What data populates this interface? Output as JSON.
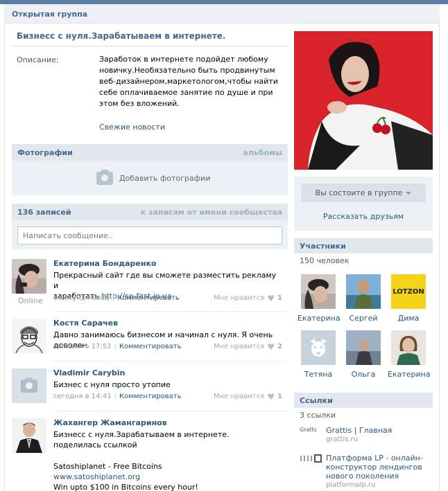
{
  "header": {
    "title": "Открытая группа"
  },
  "group": {
    "name": "Бизнесс с нуля.Зарабатываем в интернете.",
    "description_label": "Описание:",
    "description": "Заработок в интернете подойдет любому новичку.Необязательно быть продвинутым веб-дизайнером,маркетологом,чтобы найти себе оплачиваемое занятие по душе и при этом без вложений.",
    "news_link": "Свежие новости"
  },
  "photos": {
    "title": "Фотографии",
    "albums_link": "альбомы",
    "add_label": "Добавить фотографии"
  },
  "wall": {
    "count_label": "136 записей",
    "community_link": "к записям от имени сообщества",
    "input_placeholder": "Написать сообщение..",
    "posts": [
      {
        "author": "Екатерина Бондаренко",
        "online": "Online",
        "text_line1": "Прекрасный сайт где вы сможете разместить рекламу и",
        "text_line2_prefix": "заработать ",
        "text_link": "http://se-fast.io.ua",
        "time": "6 секунд назад",
        "comment": "Комментировать",
        "like_label": "Мне нравится",
        "likes": "1"
      },
      {
        "author": "Костя Сарачев",
        "text": "Давно занимаюсь бизнесом и начинал с нуля. Я очень доволен",
        "time": "сегодня в 17:52",
        "comment": "Комментировать",
        "like_label": "Мне нравится",
        "likes": "2"
      },
      {
        "author": "Vladimir Carybin",
        "text": "Бизнес с нуля просто утопие",
        "time": "сегодня в 14:41",
        "comment": "Комментировать",
        "like_label": "Мне нравится",
        "likes": "1"
      },
      {
        "author": "Жахангер Жамангаринов",
        "text": "Бизнесс с нуля.Зарабатываем в интернете. поделилась ссылкой",
        "attach_title": "Satoshiplanet - Free Bitcoins",
        "attach_url": "www.satoshiplanet.org",
        "attach_text": "Win upto $100 in Bitcoins every hour!"
      }
    ]
  },
  "sidebar": {
    "member_button": "Вы состоите в группе",
    "tell_friends": "Рассказать друзьям",
    "members_title": "Участники",
    "members_count": "150 человек",
    "members": [
      {
        "name": "Екатерина"
      },
      {
        "name": "Сергей"
      },
      {
        "name": "Дима",
        "logo": "LOTZON"
      },
      {
        "name": "Тетяна"
      },
      {
        "name": "Ольга"
      },
      {
        "name": "Екатерина"
      }
    ],
    "links_title": "Ссылки",
    "links_count": "3 ссылки",
    "links": [
      {
        "logo": "Gratts",
        "title": "Grattis | Главная",
        "url": "grattis.ru"
      },
      {
        "logo": "",
        "title": "Платформа LP - онлайн-конструктор лендингов нового поколения",
        "url": "platformalp.ru"
      }
    ]
  },
  "colors": {
    "accent": "#45688e",
    "link": "#2b587a",
    "bar": "#e1e7ed",
    "box": "#edf1f5",
    "topbar": "#597da3",
    "cover_red": "#d8232a",
    "lotzon": "#f5d21a"
  }
}
